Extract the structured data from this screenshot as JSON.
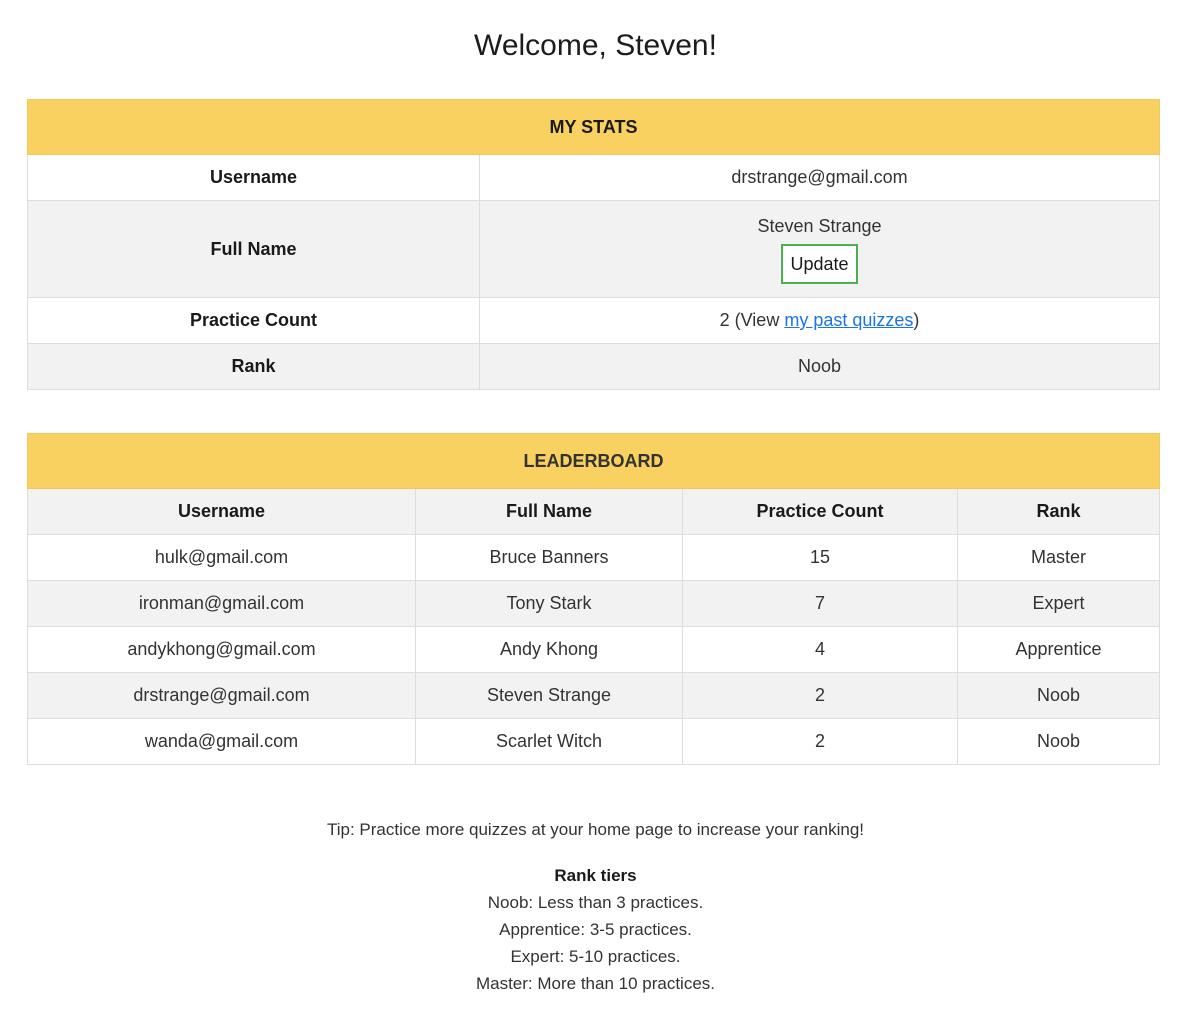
{
  "welcome": "Welcome, Steven!",
  "stats": {
    "header": "MY STATS",
    "username_label": "Username",
    "username_value": "drstrange@gmail.com",
    "fullname_label": "Full Name",
    "fullname_value": "Steven Strange",
    "update_button": "Update",
    "practice_label": "Practice Count",
    "practice_prefix": "2 (View ",
    "practice_link": "my past quizzes",
    "practice_suffix": ")",
    "rank_label": "Rank",
    "rank_value": "Noob"
  },
  "leaderboard": {
    "header": "LEADERBOARD",
    "columns": [
      "Username",
      "Full Name",
      "Practice Count",
      "Rank"
    ],
    "rows": [
      [
        "hulk@gmail.com",
        "Bruce Banners",
        "15",
        "Master"
      ],
      [
        "ironman@gmail.com",
        "Tony Stark",
        "7",
        "Expert"
      ],
      [
        "andykhong@gmail.com",
        "Andy Khong",
        "4",
        "Apprentice"
      ],
      [
        "drstrange@gmail.com",
        "Steven Strange",
        "2",
        "Noob"
      ],
      [
        "wanda@gmail.com",
        "Scarlet Witch",
        "2",
        "Noob"
      ]
    ]
  },
  "footer": {
    "tip": "Tip: Practice more quizzes at your home page to increase your ranking!",
    "tiers_title": "Rank tiers",
    "tiers": [
      "Noob: Less than 3 practices.",
      "Apprentice: 3-5 practices.",
      "Expert: 5-10 practices.",
      "Master: More than 10 practices."
    ]
  },
  "colors": {
    "header_bg": "#f9d160",
    "stripe_bg": "#f2f2f2",
    "button_border": "#4cb050",
    "link": "#1a73e8"
  }
}
